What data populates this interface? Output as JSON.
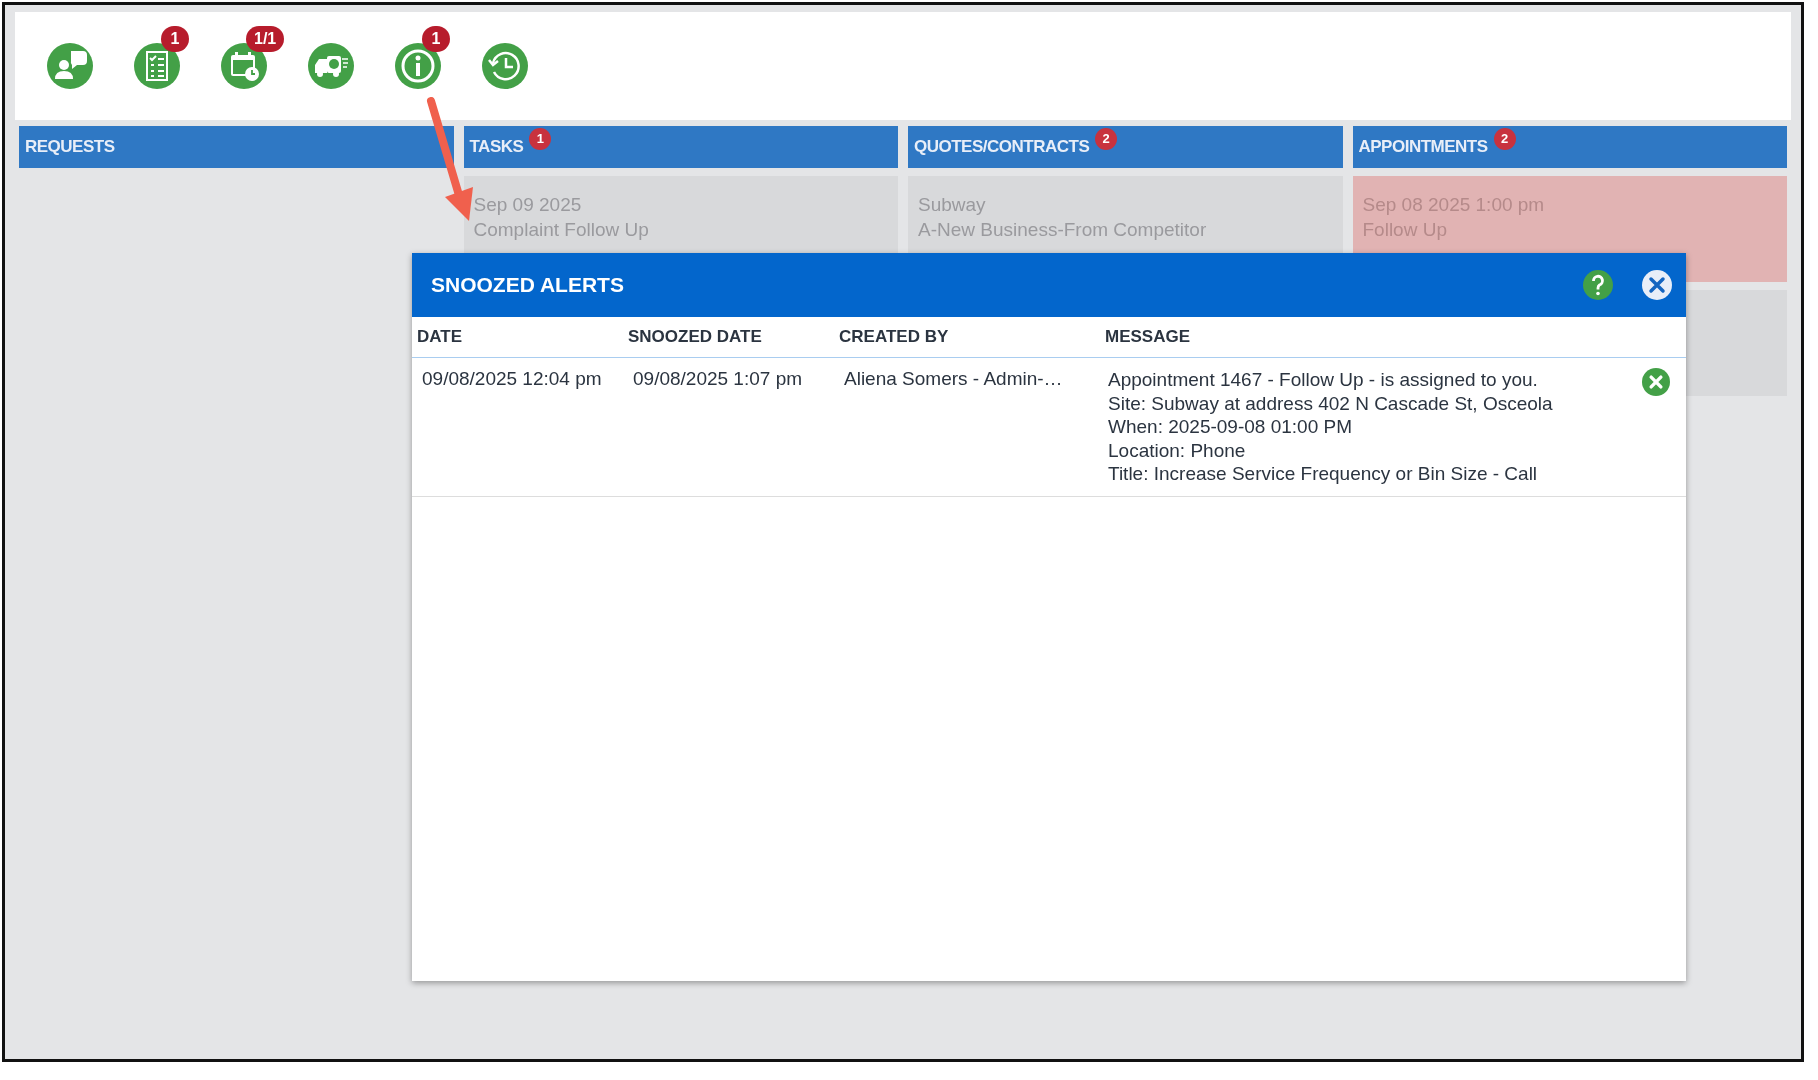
{
  "toolbar": {
    "icons": [
      {
        "kind": "person-question"
      },
      {
        "kind": "checklist",
        "badge": "1"
      },
      {
        "kind": "calendar-clock",
        "badge": "1/1"
      },
      {
        "kind": "truck"
      },
      {
        "kind": "info",
        "badge": "1"
      },
      {
        "kind": "history"
      }
    ]
  },
  "board": {
    "columns": [
      {
        "title": "REQUESTS"
      },
      {
        "title": "TASKS",
        "badge": "1",
        "cards": [
          {
            "highlighted": false,
            "lines": [
              "Sep 09 2025",
              "Complaint Follow Up"
            ]
          }
        ]
      },
      {
        "title": "QUOTES/CONTRACTS",
        "badge": "2",
        "cards": [
          {
            "highlighted": false,
            "lines": [
              "Subway",
              "A-New Business-From Competitor"
            ]
          }
        ]
      },
      {
        "title": "APPOINTMENTS",
        "badge": "2",
        "cards": [
          {
            "highlighted": true,
            "lines": [
              "Sep 08 2025 1:00 pm",
              "Follow Up"
            ]
          },
          {
            "highlighted": false
          }
        ]
      }
    ]
  },
  "dialog": {
    "title": "SNOOZED ALERTS",
    "columns": [
      "DATE",
      "SNOOZED DATE",
      "CREATED BY",
      "MESSAGE"
    ],
    "rows": [
      {
        "date": "09/08/2025 12:04 pm",
        "snoozed_date": "09/08/2025 1:07 pm",
        "created_by": "Aliena Somers - Admin-…",
        "message": [
          "Appointment 1467 - Follow Up - is assigned to you.",
          "Site: Subway at address 402 N Cascade St, Osceola",
          "When: 2025-09-08 01:00 PM",
          "Location: Phone",
          "Title: Increase Service Frequency or Bin Size - Call"
        ]
      }
    ]
  }
}
